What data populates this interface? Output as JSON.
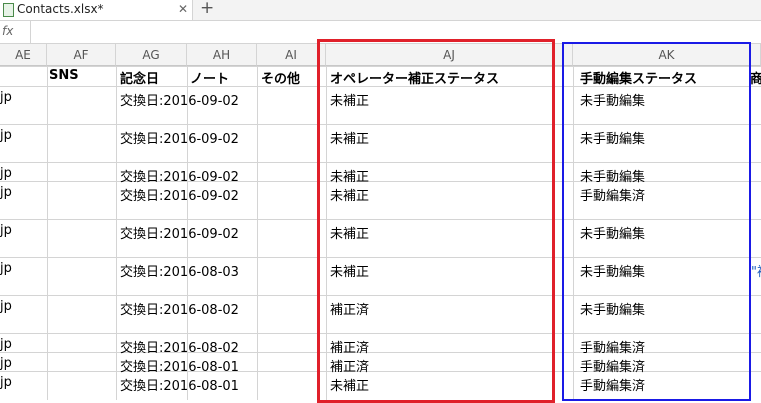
{
  "tabs": {
    "file": "Contacts.xlsx*",
    "close": "✕",
    "new": "+"
  },
  "formula_bar": {
    "fx": "fx",
    "value": ""
  },
  "columns": [
    "AE",
    "AF",
    "AG",
    "AH",
    "AI",
    "AJ",
    "AK"
  ],
  "headers": {
    "af": "SNS",
    "ag": "記念日",
    "ah": "ノート",
    "ai": "その他",
    "aj": "オペレーター補正ステータス",
    "ak": "手動編集ステータス",
    "al": "商"
  },
  "rows": [
    {
      "ae": "jp",
      "ag": "交換日:2016-09-02",
      "aj": "未補正",
      "ak": "未手動編集",
      "al": ""
    },
    {
      "ae": "jp",
      "ag": "交換日:2016-09-02",
      "aj": "未補正",
      "ak": "未手動編集",
      "al": ""
    },
    {
      "ae": "jp",
      "ag": "交換日:2016-09-02",
      "aj": "未補正",
      "ak": "未手動編集",
      "al": ""
    },
    {
      "ae": "jp",
      "ag": "交換日:2016-09-02",
      "aj": "未補正",
      "ak": "手動編集済",
      "al": ""
    },
    {
      "ae": "jp",
      "ag": "交換日:2016-09-02",
      "aj": "未補正",
      "ak": "未手動編集",
      "al": ""
    },
    {
      "ae": "jp",
      "ag": "交換日:2016-08-03",
      "aj": "未補正",
      "ak": "未手動編集",
      "al": "\"補"
    },
    {
      "ae": "jp",
      "ag": "交換日:2016-08-02",
      "aj": "補正済",
      "ak": "未手動編集",
      "al": ""
    },
    {
      "ae": "jp",
      "ag": "交換日:2016-08-02",
      "aj": "補正済",
      "ak": "手動編集済",
      "al": ""
    },
    {
      "ae": "jp",
      "ag": "交換日:2016-08-01",
      "aj": "補正済",
      "ak": "手動編集済",
      "al": ""
    },
    {
      "ae": "jp",
      "ag": "交換日:2016-08-01",
      "aj": "未補正",
      "ak": "手動編集済",
      "al": ""
    }
  ],
  "colors": {
    "highlight_red": "#e0202a",
    "highlight_blue": "#1a1ae6"
  }
}
